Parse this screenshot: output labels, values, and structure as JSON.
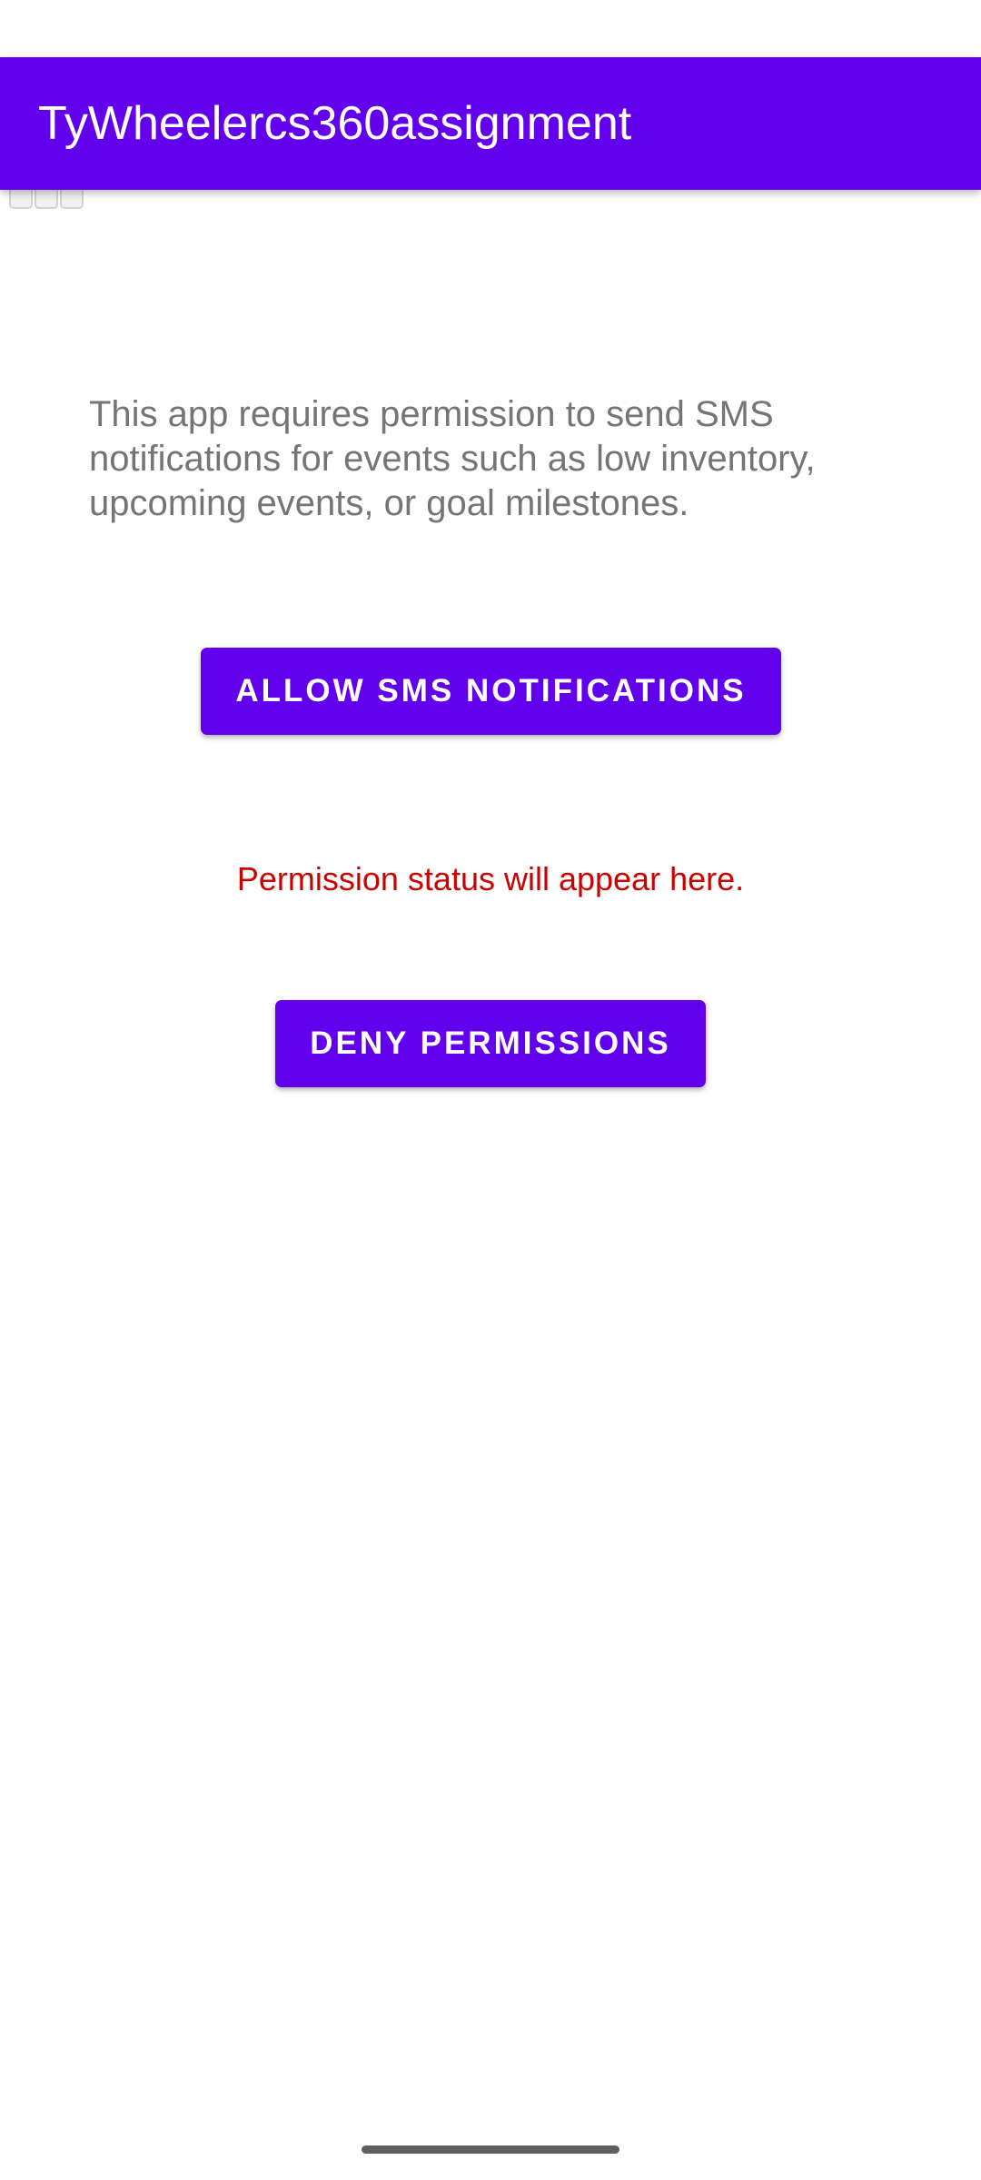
{
  "app_bar": {
    "title": "TyWheelercs360assignment"
  },
  "main": {
    "description": "This app requires permission to send SMS notifications for events such as low inventory, upcoming events, or goal milestones.",
    "allow_button_label": "ALLOW SMS NOTIFICATIONS",
    "status_text": "Permission status will appear here.",
    "deny_button_label": "DENY PERMISSIONS"
  },
  "colors": {
    "primary": "#6200ee",
    "status_text": "#cc0000",
    "description_text": "#757575"
  },
  "icons": {
    "overlay_icon": "grid-icon"
  }
}
